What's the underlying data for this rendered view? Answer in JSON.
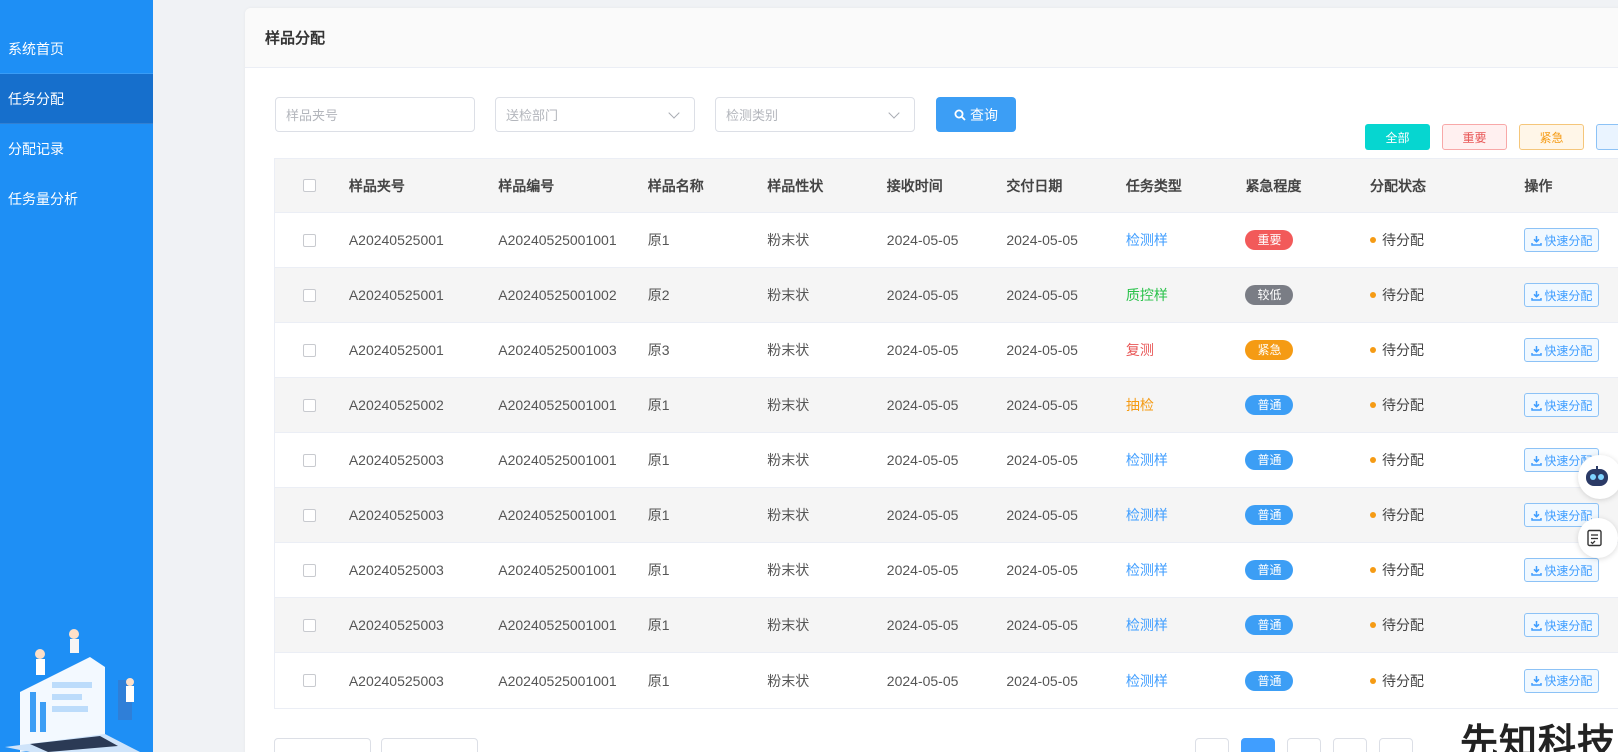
{
  "sidebar": {
    "items": [
      {
        "label": "系统首页",
        "active": false
      },
      {
        "label": "任务分配",
        "active": true
      },
      {
        "label": "分配记录",
        "active": false
      },
      {
        "label": "任务量分析",
        "active": false
      }
    ]
  },
  "page": {
    "title": "样品分配"
  },
  "filters": {
    "sample_clip_placeholder": "样品夹号",
    "department_placeholder": "送检部门",
    "test_category_placeholder": "检测类别",
    "query_label": "查询"
  },
  "tag_buttons": {
    "all": "全部",
    "important": "重要",
    "urgent": "紧急"
  },
  "table": {
    "headers": [
      "样品夹号",
      "样品编号",
      "样品名称",
      "样品性状",
      "接收时间",
      "交付日期",
      "任务类型",
      "紧急程度",
      "分配状态",
      "操作"
    ],
    "rows": [
      {
        "clip": "A20240525001",
        "code": "A20240525001001",
        "name": "原1",
        "form": "粉末状",
        "received": "2024-05-05",
        "due": "2024-05-05",
        "type": "检测样",
        "type_color": "#409eff",
        "priority": "重要",
        "priority_color": "#f25a5a",
        "status": "待分配",
        "action": "快速分配"
      },
      {
        "clip": "A20240525001",
        "code": "A20240525001002",
        "name": "原2",
        "form": "粉末状",
        "received": "2024-05-05",
        "due": "2024-05-05",
        "type": "质控样",
        "type_color": "#29c24a",
        "priority": "较低",
        "priority_color": "#7a7d85",
        "status": "待分配",
        "action": "快速分配"
      },
      {
        "clip": "A20240525001",
        "code": "A20240525001003",
        "name": "原3",
        "form": "粉末状",
        "received": "2024-05-05",
        "due": "2024-05-05",
        "type": "复测",
        "type_color": "#e85757",
        "priority": "紧急",
        "priority_color": "#f59b14",
        "status": "待分配",
        "action": "快速分配"
      },
      {
        "clip": "A20240525002",
        "code": "A20240525001001",
        "name": "原1",
        "form": "粉末状",
        "received": "2024-05-05",
        "due": "2024-05-05",
        "type": "抽检",
        "type_color": "#f59b14",
        "priority": "普通",
        "priority_color": "#3c9ef5",
        "status": "待分配",
        "action": "快速分配"
      },
      {
        "clip": "A20240525003",
        "code": "A20240525001001",
        "name": "原1",
        "form": "粉末状",
        "received": "2024-05-05",
        "due": "2024-05-05",
        "type": "检测样",
        "type_color": "#409eff",
        "priority": "普通",
        "priority_color": "#3c9ef5",
        "status": "待分配",
        "action": "快速分配"
      },
      {
        "clip": "A20240525003",
        "code": "A20240525001001",
        "name": "原1",
        "form": "粉末状",
        "received": "2024-05-05",
        "due": "2024-05-05",
        "type": "检测样",
        "type_color": "#409eff",
        "priority": "普通",
        "priority_color": "#3c9ef5",
        "status": "待分配",
        "action": "快速分配"
      },
      {
        "clip": "A20240525003",
        "code": "A20240525001001",
        "name": "原1",
        "form": "粉末状",
        "received": "2024-05-05",
        "due": "2024-05-05",
        "type": "检测样",
        "type_color": "#409eff",
        "priority": "普通",
        "priority_color": "#3c9ef5",
        "status": "待分配",
        "action": "快速分配"
      },
      {
        "clip": "A20240525003",
        "code": "A20240525001001",
        "name": "原1",
        "form": "粉末状",
        "received": "2024-05-05",
        "due": "2024-05-05",
        "type": "检测样",
        "type_color": "#409eff",
        "priority": "普通",
        "priority_color": "#3c9ef5",
        "status": "待分配",
        "action": "快速分配"
      },
      {
        "clip": "A20240525003",
        "code": "A20240525001001",
        "name": "原1",
        "form": "粉末状",
        "received": "2024-05-05",
        "due": "2024-05-05",
        "type": "检测样",
        "type_color": "#409eff",
        "priority": "普通",
        "priority_color": "#3c9ef5",
        "status": "待分配",
        "action": "快速分配"
      }
    ]
  },
  "watermark": "先知科技",
  "colors": {
    "sidebar": "#1e8ff5",
    "sidebar_active": "#166fcc",
    "primary": "#409eff",
    "pending_dot": "#f59b14"
  }
}
